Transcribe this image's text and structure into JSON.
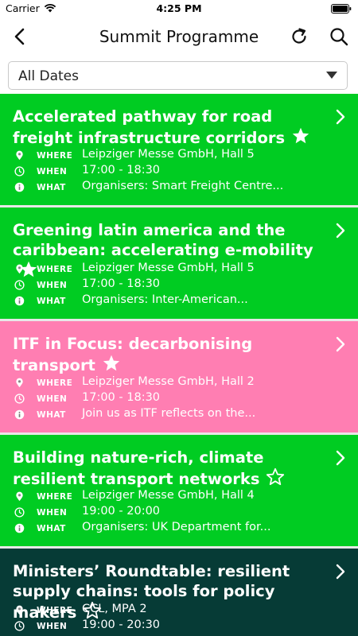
{
  "status_bar": {
    "carrier": "Carrier",
    "time": "4:25 PM"
  },
  "nav": {
    "title": "Summit Programme",
    "icons": [
      "back-icon",
      "refresh-icon",
      "search-icon"
    ]
  },
  "filter": {
    "selected": "All Dates"
  },
  "labels": {
    "where": "WHERE",
    "when": "WHEN",
    "what": "WHAT"
  },
  "colors": {
    "green": "#00cc22",
    "pink": "#ff7eb2",
    "dark": "#063b36"
  },
  "sessions": [
    {
      "title": "Accelerated pathway for road freight infrastructure corridors",
      "starred": true,
      "color": "green",
      "where": "Leipziger Messe GmbH, Hall 5",
      "when": "17:00 - 18:30",
      "what": "Organisers: Smart Freight Centre..."
    },
    {
      "title": "Greening latin america and the caribbean: accelerating e-mobility",
      "starred": true,
      "color": "green",
      "where": "Leipziger Messe GmbH, Hall 5",
      "when": "17:00 - 18:30",
      "what": "Organisers: Inter-American..."
    },
    {
      "title": "ITF in Focus: decarbonising transport",
      "starred": true,
      "color": "pink",
      "where": "Leipziger Messe GmbH, Hall 2",
      "when": "17:00 - 18:30",
      "what": "Join us as ITF reflects on the..."
    },
    {
      "title": "Building nature-rich, climate resilient transport networks",
      "starred": false,
      "color": "green",
      "where": "Leipziger Messe GmbH, Hall 4",
      "when": "19:00 - 20:00",
      "what": "Organisers: UK Department for..."
    },
    {
      "title": "Ministers’ Roundtable: resilient supply chains: tools for policy makers",
      "starred": false,
      "color": "dark",
      "where": "CCL, MPA 2",
      "when": "19:00 - 20:30",
      "what": ""
    }
  ]
}
